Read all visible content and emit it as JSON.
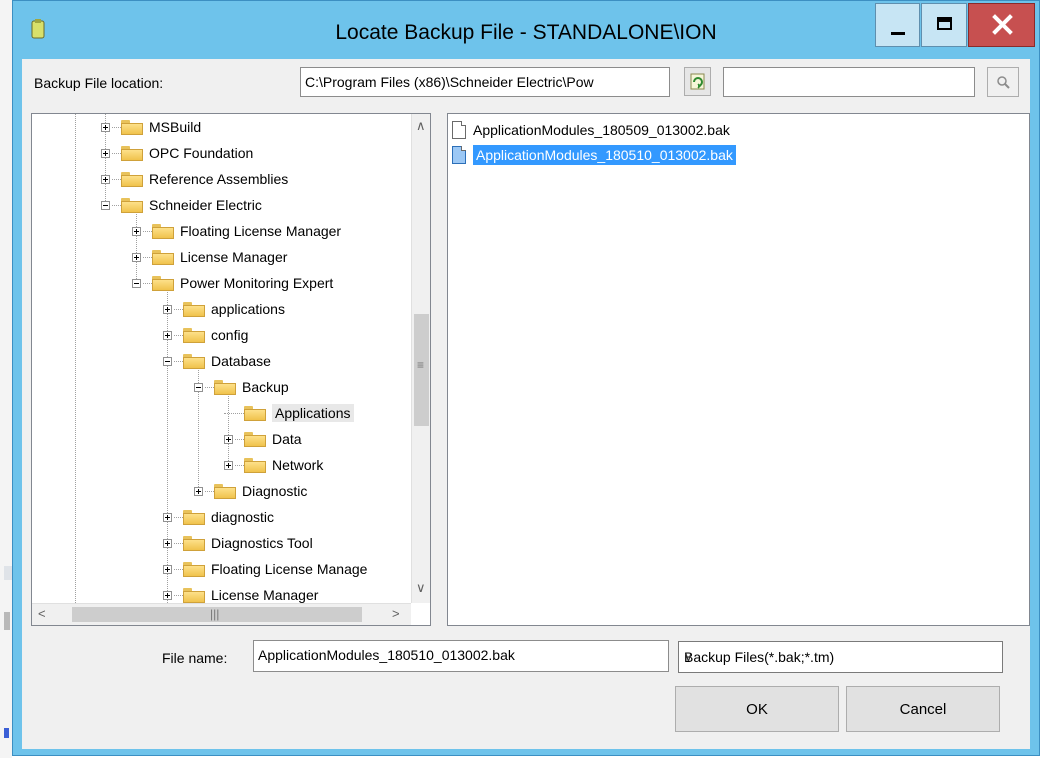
{
  "window": {
    "title": "Locate Backup File - STANDALONE\\ION"
  },
  "location": {
    "label": "Backup File location:",
    "path": "C:\\Program Files (x86)\\Schneider Electric\\Pow",
    "search_value": ""
  },
  "tree": {
    "items": [
      {
        "label": "MSBuild",
        "expander": "plus"
      },
      {
        "label": "OPC Foundation",
        "expander": "plus"
      },
      {
        "label": "Reference Assemblies",
        "expander": "plus"
      },
      {
        "label": "Schneider Electric",
        "expander": "minus"
      },
      {
        "label": "Floating License Manager",
        "expander": "plus"
      },
      {
        "label": "License Manager",
        "expander": "plus"
      },
      {
        "label": "Power Monitoring Expert",
        "expander": "minus"
      },
      {
        "label": "applications",
        "expander": "plus"
      },
      {
        "label": "config",
        "expander": "plus"
      },
      {
        "label": "Database",
        "expander": "minus"
      },
      {
        "label": "Backup",
        "expander": "minus"
      },
      {
        "label": "Applications",
        "expander": "none",
        "selected": true
      },
      {
        "label": "Data",
        "expander": "plus"
      },
      {
        "label": "Network",
        "expander": "plus"
      },
      {
        "label": "Diagnostic",
        "expander": "plus"
      },
      {
        "label": "diagnostic",
        "expander": "plus"
      },
      {
        "label": "Diagnostics Tool",
        "expander": "plus"
      },
      {
        "label": "Floating License Manage",
        "expander": "plus"
      },
      {
        "label": "License Manager",
        "expander": "plus"
      }
    ]
  },
  "files": [
    {
      "name": "ApplicationModules_180509_013002.bak",
      "selected": false
    },
    {
      "name": "ApplicationModules_180510_013002.bak",
      "selected": true
    }
  ],
  "bottom": {
    "filename_label": "File name:",
    "filename_value": "ApplicationModules_180510_013002.bak",
    "filter_value": "Backup Files(*.bak;*.tm)",
    "ok_label": "OK",
    "cancel_label": "Cancel"
  },
  "icons": {
    "minimize": "minimize-icon",
    "maximize": "maximize-icon",
    "close": "close-icon",
    "refresh": "refresh-icon",
    "search": "search-icon",
    "folder": "folder-icon",
    "file": "file-icon"
  },
  "colors": {
    "title_bar": "#6ec3eb",
    "close_button": "#c75050",
    "selection": "#3399ff",
    "folder": "#f0c24c"
  }
}
